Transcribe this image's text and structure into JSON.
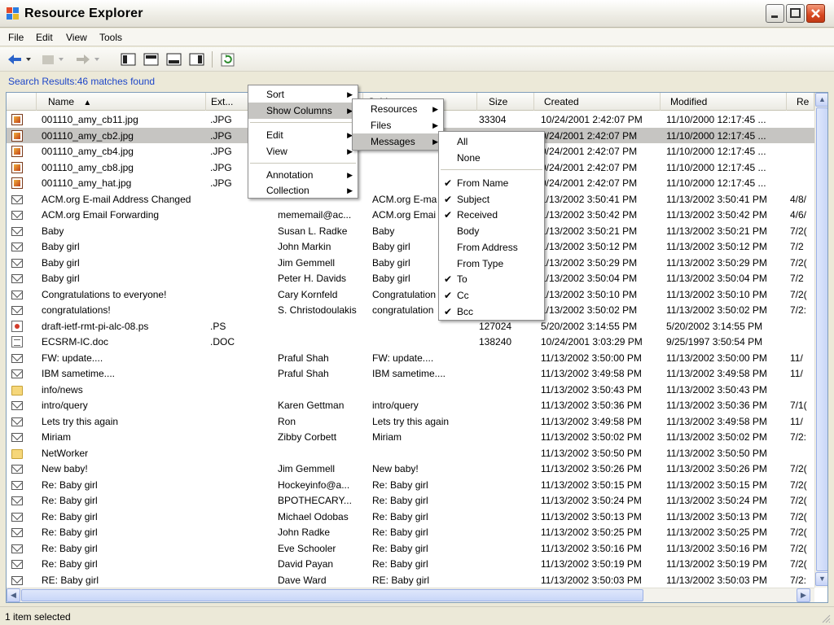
{
  "window": {
    "title": "Resource Explorer"
  },
  "menubar": {
    "items": [
      "File",
      "Edit",
      "View",
      "Tools"
    ]
  },
  "search": {
    "label": "Search Results:46 matches found"
  },
  "columns": [
    "Name",
    "Ext...",
    "",
    "Subject",
    "Size",
    "Created",
    "Modified",
    "Re"
  ],
  "sort_indicator": "▲",
  "rows": [
    {
      "icon": "image",
      "name": "001110_amy_cb11.jpg",
      "ext": ".JPG",
      "from": "",
      "subject": "",
      "size": "33304",
      "created": "10/24/2001 2:42:07 PM",
      "modified": "11/10/2000 12:17:45 ...",
      "re": ""
    },
    {
      "icon": "image",
      "name": "001110_amy_cb2.jpg",
      "ext": ".JPG",
      "from": "",
      "subject": "",
      "size": "",
      "created": "0/24/2001 2:42:07 PM",
      "modified": "11/10/2000 12:17:45 ...",
      "re": "",
      "selected": true
    },
    {
      "icon": "image",
      "name": "001110_amy_cb4.jpg",
      "ext": ".JPG",
      "from": "",
      "subject": "",
      "size": "",
      "created": "0/24/2001 2:42:07 PM",
      "modified": "11/10/2000 12:17:45 ...",
      "re": ""
    },
    {
      "icon": "image",
      "name": "001110_amy_cb8.jpg",
      "ext": ".JPG",
      "from": "",
      "subject": "",
      "size": "",
      "created": "0/24/2001 2:42:07 PM",
      "modified": "11/10/2000 12:17:45 ...",
      "re": ""
    },
    {
      "icon": "image",
      "name": "001110_amy_hat.jpg",
      "ext": ".JPG",
      "from": "",
      "subject": "",
      "size": "",
      "created": "0/24/2001 2:42:07 PM",
      "modified": "11/10/2000 12:17:45 ...",
      "re": ""
    },
    {
      "icon": "mail",
      "name": "ACM.org E-mail Address Changed",
      "ext": "",
      "from": "",
      "subject": "ACM.org E-ma",
      "size": "",
      "created": "1/13/2002 3:50:41 PM",
      "modified": "11/13/2002 3:50:41 PM",
      "re": "4/8/"
    },
    {
      "icon": "mail",
      "name": "ACM.org Email Forwarding",
      "ext": "",
      "from": "mememail@ac...",
      "subject": "ACM.org Emai",
      "size": "",
      "created": "1/13/2002 3:50:42 PM",
      "modified": "11/13/2002 3:50:42 PM",
      "re": "4/6/"
    },
    {
      "icon": "mail",
      "name": "Baby",
      "ext": "",
      "from": "Susan L. Radke",
      "subject": "Baby",
      "size": "",
      "created": "1/13/2002 3:50:21 PM",
      "modified": "11/13/2002 3:50:21 PM",
      "re": "7/2("
    },
    {
      "icon": "mail",
      "name": "Baby girl",
      "ext": "",
      "from": "John Markin",
      "subject": "Baby girl",
      "size": "",
      "created": "1/13/2002 3:50:12 PM",
      "modified": "11/13/2002 3:50:12 PM",
      "re": "7/2"
    },
    {
      "icon": "mail",
      "name": "Baby girl",
      "ext": "",
      "from": "Jim Gemmell",
      "subject": "Baby girl",
      "size": "",
      "created": "1/13/2002 3:50:29 PM",
      "modified": "11/13/2002 3:50:29 PM",
      "re": "7/2("
    },
    {
      "icon": "mail",
      "name": "Baby girl",
      "ext": "",
      "from": "Peter H. Davids",
      "subject": "Baby girl",
      "size": "",
      "created": "1/13/2002 3:50:04 PM",
      "modified": "11/13/2002 3:50:04 PM",
      "re": "7/2"
    },
    {
      "icon": "mail",
      "name": "Congratulations to everyone!",
      "ext": "",
      "from": "Cary Kornfeld",
      "subject": "Congratulation",
      "size": "",
      "created": "1/13/2002 3:50:10 PM",
      "modified": "11/13/2002 3:50:10 PM",
      "re": "7/2("
    },
    {
      "icon": "mail",
      "name": "congratulations!",
      "ext": "",
      "from": "S. Christodoulakis",
      "subject": "congratulation",
      "size": "",
      "created": "1/13/2002 3:50:02 PM",
      "modified": "11/13/2002 3:50:02 PM",
      "re": "7/2:"
    },
    {
      "icon": "ps",
      "name": "draft-ietf-rmt-pi-alc-08.ps",
      "ext": ".PS",
      "from": "",
      "subject": "",
      "size": "127024",
      "created": "5/20/2002 3:14:55 PM",
      "modified": "5/20/2002 3:14:55 PM",
      "re": ""
    },
    {
      "icon": "doc",
      "name": "ECSRM-IC.doc",
      "ext": ".DOC",
      "from": "",
      "subject": "",
      "size": "138240",
      "created": "10/24/2001 3:03:29 PM",
      "modified": "9/25/1997 3:50:54 PM",
      "re": ""
    },
    {
      "icon": "mail",
      "name": "FW: update....",
      "ext": "",
      "from": "Praful Shah",
      "subject": "FW: update....",
      "size": "",
      "created": "11/13/2002 3:50:00 PM",
      "modified": "11/13/2002 3:50:00 PM",
      "re": "11/"
    },
    {
      "icon": "mail",
      "name": "IBM sametime....",
      "ext": "",
      "from": "Praful Shah",
      "subject": "IBM sametime....",
      "size": "",
      "created": "11/13/2002 3:49:58 PM",
      "modified": "11/13/2002 3:49:58 PM",
      "re": "11/"
    },
    {
      "icon": "folder",
      "name": "info/news",
      "ext": "",
      "from": "",
      "subject": "",
      "size": "",
      "created": "11/13/2002 3:50:43 PM",
      "modified": "11/13/2002 3:50:43 PM",
      "re": ""
    },
    {
      "icon": "mail",
      "name": "intro/query",
      "ext": "",
      "from": "Karen Gettman",
      "subject": "intro/query",
      "size": "",
      "created": "11/13/2002 3:50:36 PM",
      "modified": "11/13/2002 3:50:36 PM",
      "re": "7/1("
    },
    {
      "icon": "mail",
      "name": "Lets try this again",
      "ext": "",
      "from": "Ron",
      "subject": "Lets try this again",
      "size": "",
      "created": "11/13/2002 3:49:58 PM",
      "modified": "11/13/2002 3:49:58 PM",
      "re": "11/"
    },
    {
      "icon": "mail",
      "name": "Miriam",
      "ext": "",
      "from": "Zibby Corbett",
      "subject": "Miriam",
      "size": "",
      "created": "11/13/2002 3:50:02 PM",
      "modified": "11/13/2002 3:50:02 PM",
      "re": "7/2:"
    },
    {
      "icon": "folder",
      "name": "NetWorker",
      "ext": "",
      "from": "",
      "subject": "",
      "size": "",
      "created": "11/13/2002 3:50:50 PM",
      "modified": "11/13/2002 3:50:50 PM",
      "re": ""
    },
    {
      "icon": "mail",
      "name": "New baby!",
      "ext": "",
      "from": "Jim Gemmell",
      "subject": "New baby!",
      "size": "",
      "created": "11/13/2002 3:50:26 PM",
      "modified": "11/13/2002 3:50:26 PM",
      "re": "7/2("
    },
    {
      "icon": "mail",
      "name": "Re:  Baby girl",
      "ext": "",
      "from": "Hockeyinfo@a...",
      "subject": "Re:  Baby girl",
      "size": "",
      "created": "11/13/2002 3:50:15 PM",
      "modified": "11/13/2002 3:50:15 PM",
      "re": "7/2("
    },
    {
      "icon": "mail",
      "name": "Re: Baby girl",
      "ext": "",
      "from": "BPOTHECARY...",
      "subject": "Re: Baby girl",
      "size": "",
      "created": "11/13/2002 3:50:24 PM",
      "modified": "11/13/2002 3:50:24 PM",
      "re": "7/2("
    },
    {
      "icon": "mail",
      "name": "Re: Baby girl",
      "ext": "",
      "from": "Michael Odobas",
      "subject": "Re: Baby girl",
      "size": "",
      "created": "11/13/2002 3:50:13 PM",
      "modified": "11/13/2002 3:50:13 PM",
      "re": "7/2("
    },
    {
      "icon": "mail",
      "name": "Re: Baby girl",
      "ext": "",
      "from": "John Radke",
      "subject": "Re: Baby girl",
      "size": "",
      "created": "11/13/2002 3:50:25 PM",
      "modified": "11/13/2002 3:50:25 PM",
      "re": "7/2("
    },
    {
      "icon": "mail",
      "name": "Re: Baby girl",
      "ext": "",
      "from": "Eve Schooler",
      "subject": "Re: Baby girl",
      "size": "",
      "created": "11/13/2002 3:50:16 PM",
      "modified": "11/13/2002 3:50:16 PM",
      "re": "7/2("
    },
    {
      "icon": "mail",
      "name": "Re: Baby girl",
      "ext": "",
      "from": "David Payan",
      "subject": "Re: Baby girl",
      "size": "",
      "created": "11/13/2002 3:50:19 PM",
      "modified": "11/13/2002 3:50:19 PM",
      "re": "7/2("
    },
    {
      "icon": "mail",
      "name": "RE: Baby girl",
      "ext": "",
      "from": "Dave Ward",
      "subject": "RE: Baby girl",
      "size": "",
      "created": "11/13/2002 3:50:03 PM",
      "modified": "11/13/2002 3:50:03 PM",
      "re": "7/2:"
    }
  ],
  "context_menu": {
    "items": [
      "Sort",
      "Show Columns",
      "Edit",
      "View",
      "Annotation",
      "Collection"
    ]
  },
  "show_columns_menu": {
    "items": [
      "Resources",
      "Files",
      "Messages"
    ]
  },
  "messages_menu": {
    "top": [
      "All",
      "None"
    ],
    "columns": [
      {
        "label": "From Name",
        "checked": true
      },
      {
        "label": "Subject",
        "checked": true
      },
      {
        "label": "Received",
        "checked": true
      },
      {
        "label": "Body",
        "checked": false
      },
      {
        "label": "From Address",
        "checked": false
      },
      {
        "label": "From Type",
        "checked": false
      },
      {
        "label": "To",
        "checked": true
      },
      {
        "label": "Cc",
        "checked": true
      },
      {
        "label": "Bcc",
        "checked": true
      }
    ]
  },
  "status": {
    "text": "1 item selected"
  },
  "colors": {
    "accent": "#1f47c8",
    "selection": "#c6c5c2",
    "close": "#d6461f"
  }
}
